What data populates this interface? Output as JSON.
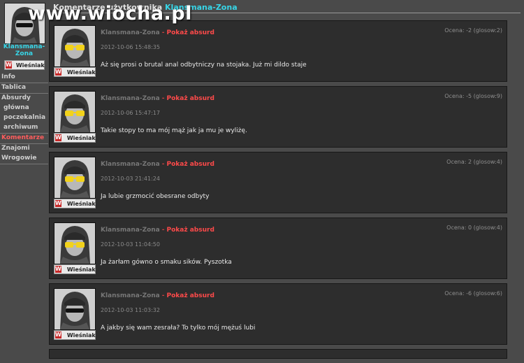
{
  "watermark": "www.wiocha.pl",
  "header": {
    "prefix": "Komentarze użytkownika",
    "username": "Klansmana-Zona"
  },
  "sidebar": {
    "username_line1": "Klansmana-",
    "username_line2": "Zona",
    "rank": "Wieśniak",
    "menu": [
      {
        "label": "Info"
      },
      {
        "label": "Tablica"
      },
      {
        "label": "Absurdy"
      },
      {
        "label": "główna"
      },
      {
        "label": "poczekalnia"
      },
      {
        "label": "archiwum"
      },
      {
        "label": "Komentarze"
      },
      {
        "label": "Znajomi"
      },
      {
        "label": "Wrogowie"
      }
    ]
  },
  "absurd_label": "Pokaż absurd",
  "comments": [
    {
      "author": "Klansmana-Zona",
      "date": "2012-10-06 15:48:35",
      "score": "Ocena: -2 (glosow:2)",
      "text": "Aż się prosi o brutal anal odbytniczy na stojaka. Już mi dildo staje",
      "rank": "Wieśniak"
    },
    {
      "author": "Klansmana-Zona",
      "date": "2012-10-06 15:47:17",
      "score": "Ocena: -5 (glosow:9)",
      "text": "Takie stopy to ma mój mąż jak ja mu je wyliżę.",
      "rank": "Wieśniak"
    },
    {
      "author": "Klansmana-Zona",
      "date": "2012-10-03 21:41:24",
      "score": "Ocena: 2 (glosow:4)",
      "text": "Ja lubie grzmocić obesrane odbyty",
      "rank": "Wieśniak"
    },
    {
      "author": "Klansmana-Zona",
      "date": "2012-10-03 11:04:50",
      "score": "Ocena: 0 (glosow:4)",
      "text": "Ja żarłam gówno o smaku sików. Pyszotka",
      "rank": "Wieśniak"
    },
    {
      "author": "Klansmana-Zona",
      "date": "2012-10-03 11:03:32",
      "score": "Ocena: -6 (glosow:6)",
      "text": "A jakby się wam zesrała? To tylko mój mężuś lubi",
      "rank": "Wieśniak"
    }
  ],
  "colors": {
    "background": "#4a4a4a",
    "comment_bg": "#2d2d2d",
    "username": "#37d6e8",
    "absurd_link": "#ff4a4a",
    "active_menu": "#ff5c5c"
  },
  "icons": {
    "rank_badge": "rank-badge-icon",
    "avatar": "avatar-photo-icon"
  }
}
